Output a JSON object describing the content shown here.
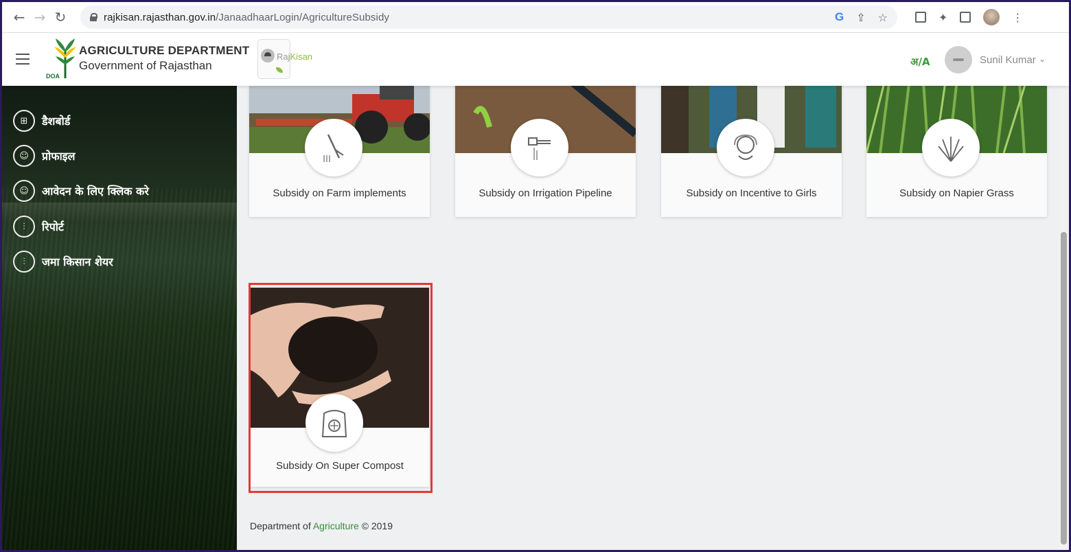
{
  "browser": {
    "url_domain": "rajkisan.rajasthan.gov.in",
    "url_path": "/JanaadhaarLogin/AgricultureSubsidy",
    "g_icon": "G"
  },
  "header": {
    "title": "AGRICULTURE DEPARTMENT",
    "subtitle": "Government of Rajasthan",
    "logo_text": "DOA",
    "rajkisan_raj": "Raj",
    "rajkisan_kisan": "Kisan",
    "lang_toggle": "अ/A",
    "user_name": "Sunil Kumar"
  },
  "sidebar": {
    "items": [
      {
        "label": "डैशबोर्ड",
        "icon": "dashboard-icon"
      },
      {
        "label": "प्रोफाइल",
        "icon": "user-icon"
      },
      {
        "label": "आवेदन के लिए क्लिक करे",
        "icon": "user-icon"
      },
      {
        "label": "रिपोर्ट",
        "icon": "sliders-icon"
      },
      {
        "label": "जमा किसान शेयर",
        "icon": "sliders-icon"
      }
    ]
  },
  "cards": [
    {
      "label": "Subsidy on Farm implements",
      "icon": "farm-tool-icon"
    },
    {
      "label": "Subsidy on Irrigation Pipeline",
      "icon": "pipeline-icon"
    },
    {
      "label": "Subsidy on Incentive to Girls",
      "icon": "girl-icon"
    },
    {
      "label": "Subsidy on Napier Grass",
      "icon": "grass-icon"
    },
    {
      "label": "Subsidy On Super Compost",
      "icon": "compost-bag-icon",
      "highlighted": true
    }
  ],
  "footer": {
    "prefix": "Department of",
    "agri": "Agriculture",
    "suffix": "© 2019"
  },
  "colors": {
    "highlight": "#e53935",
    "brand_green": "#3a9b3a"
  }
}
